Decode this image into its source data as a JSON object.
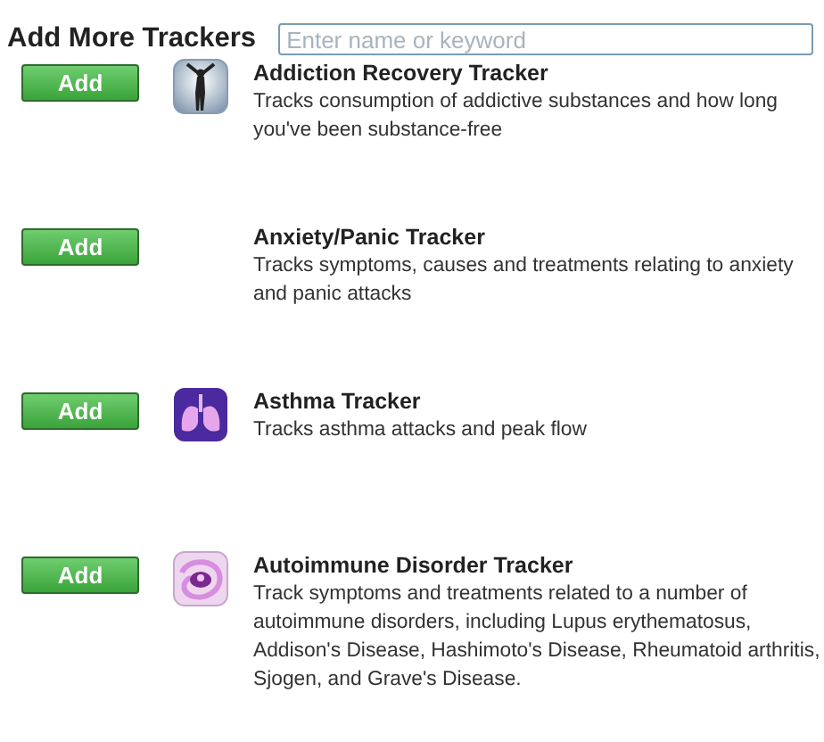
{
  "header": {
    "title": "Add More Trackers",
    "search": {
      "placeholder": "Enter name or keyword"
    }
  },
  "trackers": [
    {
      "button": "Add",
      "has_icon": true,
      "name": "Addiction Recovery Tracker",
      "description": "Tracks consumption of addictive substances and how long you've been substance-free"
    },
    {
      "button": "Add",
      "has_icon": false,
      "name": "Anxiety/Panic Tracker",
      "description": "Tracks symptoms, causes and treatments relating to anxiety and panic attacks"
    },
    {
      "button": "Add",
      "has_icon": true,
      "name": "Asthma Tracker",
      "description": "Tracks asthma attacks and peak flow"
    },
    {
      "button": "Add",
      "has_icon": true,
      "name": "Autoimmune Disorder Tracker",
      "description": "Track symptoms and treatments related to a number of autoimmune disorders, including Lupus erythematosus, Addison's Disease, Hashimoto's Disease, Rheumatoid arthritis, Sjogen, and Grave's Disease."
    }
  ]
}
